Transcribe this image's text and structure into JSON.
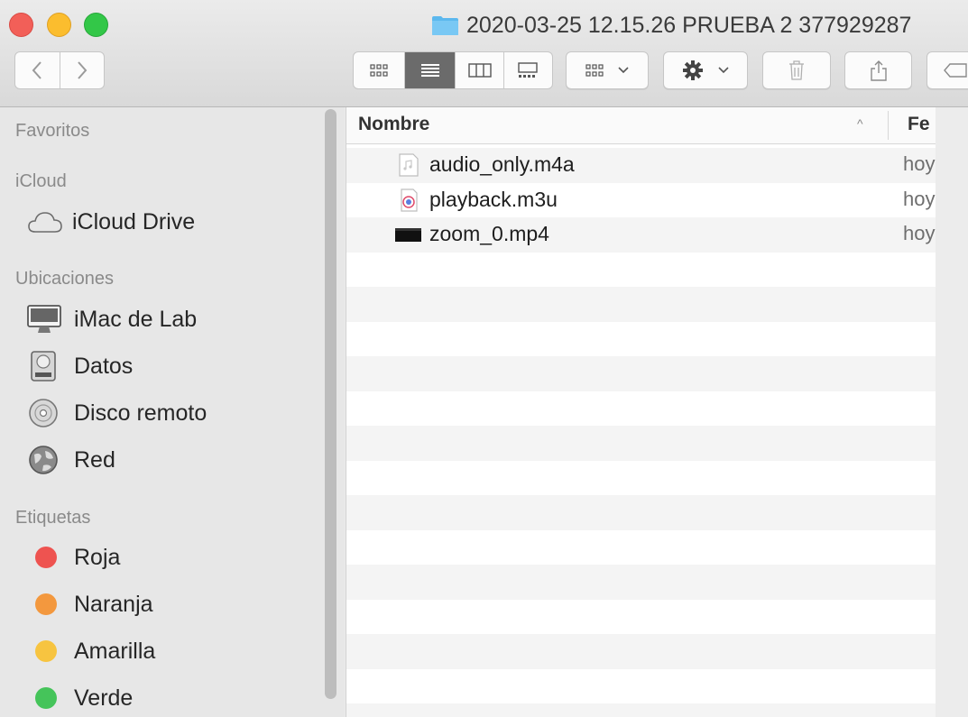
{
  "window": {
    "title": "2020-03-25 12.15.26 PRUEBA 2 377929287"
  },
  "toolbar": {
    "back_icon": "chevron-left-icon",
    "forward_icon": "chevron-right-icon",
    "view_modes": [
      "icons",
      "list",
      "columns",
      "gallery"
    ],
    "active_view": "list",
    "group_icon": "group-icon",
    "action_icon": "gear-icon",
    "delete_icon": "trash-icon",
    "share_icon": "share-icon",
    "tag_icon": "tag-icon"
  },
  "sidebar": {
    "favorites_header": "Favoritos",
    "icloud_header": "iCloud",
    "icloud_items": [
      {
        "label": "iCloud Drive",
        "icon": "cloud-icon"
      }
    ],
    "locations_header": "Ubicaciones",
    "location_items": [
      {
        "label": "iMac de Lab",
        "icon": "imac-icon"
      },
      {
        "label": "Datos",
        "icon": "disk-icon"
      },
      {
        "label": "Disco remoto",
        "icon": "remote-disc-icon"
      },
      {
        "label": "Red",
        "icon": "network-icon"
      }
    ],
    "tags_header": "Etiquetas",
    "tag_items": [
      {
        "label": "Roja",
        "color": "#ee5350"
      },
      {
        "label": "Naranja",
        "color": "#f3983e"
      },
      {
        "label": "Amarilla",
        "color": "#f7c440"
      },
      {
        "label": "Verde",
        "color": "#45c45a"
      }
    ]
  },
  "file_list": {
    "columns": {
      "name": "Nombre",
      "date": "Fe"
    },
    "files": [
      {
        "name": "audio_only.m4a",
        "date": "hoy",
        "icon": "audio-file-icon"
      },
      {
        "name": "playback.m3u",
        "date": "hoy",
        "icon": "playlist-file-icon"
      },
      {
        "name": "zoom_0.mp4",
        "date": "hoy",
        "icon": "video-file-icon"
      }
    ]
  }
}
